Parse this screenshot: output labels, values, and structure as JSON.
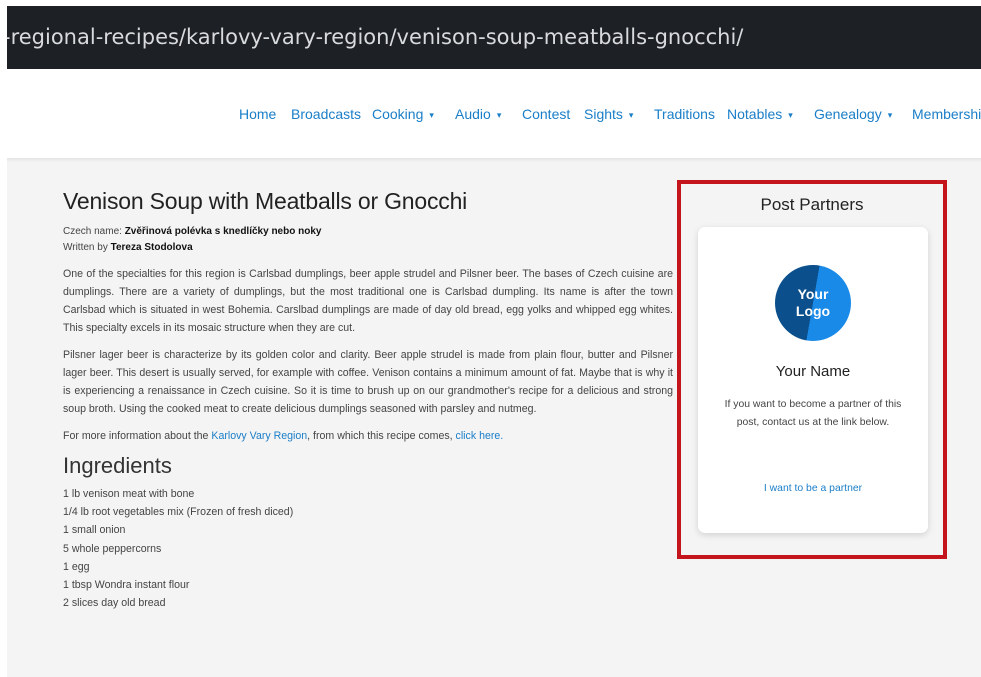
{
  "browser": {
    "url": "-regional-recipes/karlovy-vary-region/venison-soup-meatballs-gnocchi/"
  },
  "nav": {
    "home": "Home",
    "broadcasts": "Broadcasts",
    "cooking": "Cooking",
    "audio": "Audio",
    "contest": "Contest",
    "sights": "Sights",
    "traditions": "Traditions",
    "notables": "Notables",
    "genealogy": "Genealogy",
    "membership": "Membershi",
    "caret": "▾"
  },
  "article": {
    "title": "Venison Soup with Meatballs or Gnocchi",
    "czech_label": "Czech name: ",
    "czech_name": "Zvěřinová polévka s knedlíčky nebo noky",
    "written_label": "Written by ",
    "author": "Tereza Stodolova",
    "para1": "One of the specialties for this region is Carlsbad dumplings, beer apple strudel and Pilsner beer. The bases of Czech cuisine are dumplings. There are a variety of dumplings, but the most traditional one is Carlsbad dumpling. Its name is after the town Carlsbad which is situated in west Bohemia. Carslbad dumplings are made of day old bread, egg yolks and whipped egg whites. This specialty excels in its mosaic structure when they are cut.",
    "para2": "Pilsner lager beer is characterize by its golden color and clarity. Beer apple strudel is made from plain flour, butter and Pilsner lager beer. This desert is usually served, for example with coffee. Venison contains a minimum amount of fat. Maybe that is why it is experiencing a renaissance in Czech cuisine. So it is time to brush up on our grandmother's recipe for a delicious and strong soup broth. Using the cooked meat to create delicious dumplings seasoned with parsley and nutmeg.",
    "info_pre": "For more information about the ",
    "info_link": "Karlovy Vary Region",
    "info_mid": ", from which this recipe comes, ",
    "info_click": "click here.",
    "ingredients_heading": "Ingredients",
    "ingredients": [
      "1 lb venison meat with bone",
      "1/4 lb root vegetables mix (Frozen of fresh diced)",
      "1 small onion",
      "5 whole peppercorns",
      "1 egg",
      "1 tbsp Wondra instant flour",
      "2 slices day old bread"
    ]
  },
  "sidebar": {
    "title": "Post Partners",
    "logo_line1": "Your",
    "logo_line2": "Logo",
    "name": "Your Name",
    "description": "If you want to become a partner of this post, contact us at the link below.",
    "link": "I want to be a partner"
  }
}
